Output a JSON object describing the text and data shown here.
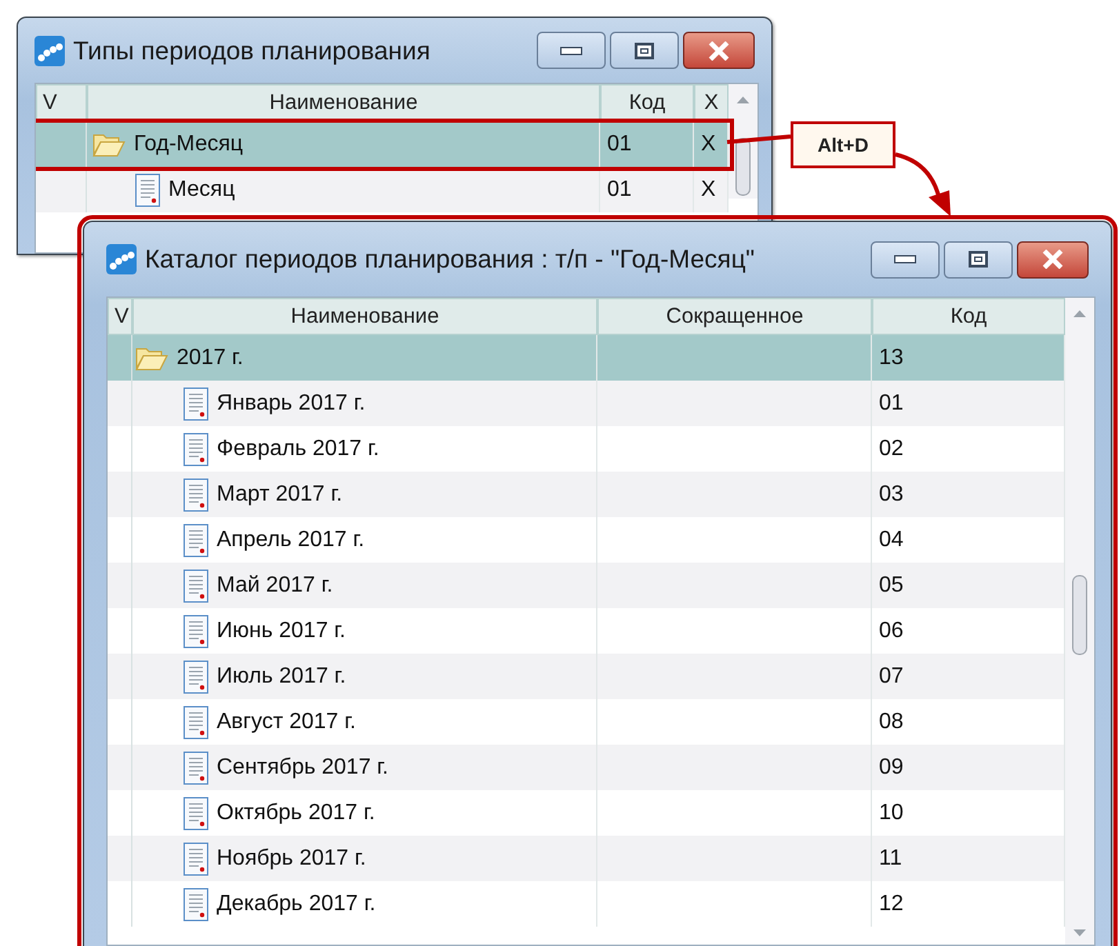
{
  "windows": [
    {
      "title": "Типы периодов планирования",
      "highlighted": false,
      "columns": [
        {
          "label": "V"
        },
        {
          "label": "Наименование"
        },
        {
          "label": "Код"
        },
        {
          "label": "X"
        }
      ],
      "rows": [
        {
          "kind": "folder",
          "name": "Год-Месяц",
          "code": "01",
          "flag": "X",
          "selected": true,
          "highlighted": true,
          "children": [
            {
              "kind": "document",
              "name": "Месяц",
              "code": "01",
              "flag": "X",
              "selected": false,
              "highlighted": false
            }
          ]
        }
      ]
    },
    {
      "title": "Каталог периодов планирования : т/п - \"Год-Месяц\"",
      "highlighted": true,
      "columns": [
        {
          "label": "V"
        },
        {
          "label": "Наименование"
        },
        {
          "label": "Сокращенное"
        },
        {
          "label": "Код"
        }
      ],
      "rows": [
        {
          "kind": "folder",
          "name": "2017 г.",
          "code": "13",
          "selected": true,
          "highlighted": false,
          "children": [
            {
              "kind": "document",
              "name": "Январь 2017 г.",
              "code": "01",
              "selected": false,
              "highlighted": false
            },
            {
              "kind": "document",
              "name": "Февраль 2017 г.",
              "code": "02",
              "selected": false,
              "highlighted": false
            },
            {
              "kind": "document",
              "name": "Март 2017 г.",
              "code": "03",
              "selected": false,
              "highlighted": false
            },
            {
              "kind": "document",
              "name": "Апрель 2017 г.",
              "code": "04",
              "selected": false,
              "highlighted": false
            },
            {
              "kind": "document",
              "name": "Май 2017 г.",
              "code": "05",
              "selected": false,
              "highlighted": false
            },
            {
              "kind": "document",
              "name": "Июнь 2017 г.",
              "code": "06",
              "selected": false,
              "highlighted": false
            },
            {
              "kind": "document",
              "name": "Июль 2017 г.",
              "code": "07",
              "selected": false,
              "highlighted": false
            },
            {
              "kind": "document",
              "name": "Август 2017 г.",
              "code": "08",
              "selected": false,
              "highlighted": false
            },
            {
              "kind": "document",
              "name": "Сентябрь 2017 г.",
              "code": "09",
              "selected": false,
              "highlighted": false
            },
            {
              "kind": "document",
              "name": "Октябрь 2017 г.",
              "code": "10",
              "selected": false,
              "highlighted": false
            },
            {
              "kind": "document",
              "name": "Ноябрь 2017 г.",
              "code": "11",
              "selected": false,
              "highlighted": false
            },
            {
              "kind": "document",
              "name": "Декабрь 2017 г.",
              "code": "12",
              "selected": false,
              "highlighted": false
            }
          ]
        }
      ]
    }
  ],
  "callout": {
    "label": "Alt+D"
  }
}
